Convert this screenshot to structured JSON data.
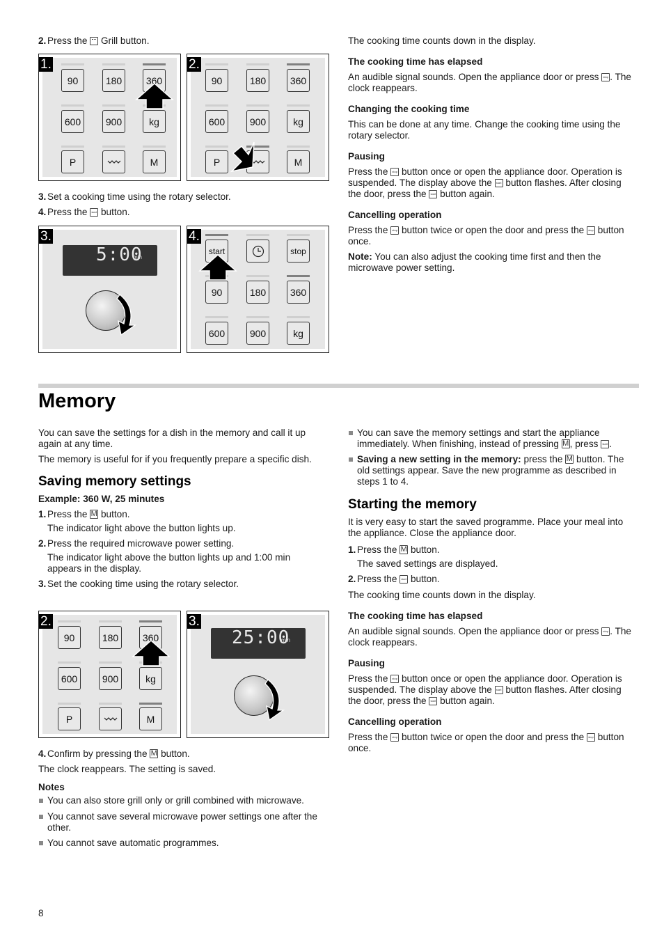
{
  "top_left": {
    "step2": {
      "num": "2.",
      "pre": "Press the",
      "icon": "grill-key-icon",
      "post": "Grill button."
    },
    "step3": {
      "num": "3.",
      "text": "Set a cooking time using the rotary selector."
    },
    "step4": {
      "num": "4.",
      "pre": "Press the",
      "icon": "start-key-icon",
      "post": "button."
    },
    "figures": {
      "fig1": {
        "tag": "1.",
        "keys": [
          "90",
          "180",
          "360",
          "600",
          "900",
          "kg",
          "P",
          "grill",
          "M"
        ],
        "active_indicators": [
          "360"
        ],
        "arrow": "up-arrow on 360"
      },
      "fig2": {
        "tag": "2.",
        "keys": [
          "90",
          "180",
          "360",
          "600",
          "900",
          "kg",
          "P",
          "grill",
          "M"
        ],
        "active_indicators": [
          "360",
          "grill"
        ],
        "arrow": "diagonal arrow on grill"
      },
      "fig3": {
        "tag": "3.",
        "display": "5:00",
        "display_unit": "min"
      },
      "fig4": {
        "tag": "4.",
        "keys": [
          "start",
          "clock",
          "stop",
          "90",
          "180",
          "360",
          "600",
          "900",
          "kg"
        ],
        "active_indicators": [
          "start",
          "360"
        ],
        "arrow": "up-arrow on start"
      }
    }
  },
  "top_right": {
    "intro": "The cooking time counts down in the display.",
    "sections": [
      {
        "heading": "The cooking time has elapsed",
        "text_a": "An audible signal sounds. Open the appliance door or press",
        "text_b": ". The clock reappears."
      },
      {
        "heading": "Changing the cooking time",
        "text": "This can be done at any time. Change the cooking time using the rotary selector."
      },
      {
        "heading": "Pausing",
        "t1": "Press the",
        "t2": "button once or open the appliance door. Operation is suspended. The display above the",
        "t3": "button flashes. After closing the door, press the",
        "t4": "button again."
      },
      {
        "heading": "Cancelling operation",
        "t1": "Press the",
        "t2": "button twice or open the door and press the",
        "t3": "button once."
      }
    ],
    "note_label": "Note:",
    "note_text": "You can also adjust the cooking time first and then the microwave power setting."
  },
  "memory": {
    "title": "Memory",
    "intro1": "You can save the settings for a dish in the memory and call it up again at any time.",
    "intro2": "The memory is useful for if you frequently prepare a specific dish.",
    "saving": {
      "heading": "Saving memory settings",
      "example": "Example: 360 W, 25 minutes",
      "steps": [
        {
          "num": "1.",
          "pre": "Press the",
          "key": "M",
          "post": "button.",
          "sub": "The indicator light above the button lights up."
        },
        {
          "num": "2.",
          "text": "Press the required microwave power setting.",
          "sub": "The indicator light above the button lights up and 1:00 min appears in the display."
        },
        {
          "num": "3.",
          "text": "Set the cooking time using the rotary selector."
        },
        {
          "num": "4.",
          "pre": "Confirm by pressing the",
          "key": "M",
          "post": "button."
        }
      ],
      "figures": {
        "fig2": {
          "tag": "2.",
          "keys": [
            "90",
            "180",
            "360",
            "600",
            "900",
            "kg",
            "P",
            "grill",
            "M"
          ],
          "active_indicators": [
            "360",
            "M"
          ]
        },
        "fig3": {
          "tag": "3.",
          "display": "25:00",
          "display_unit": "min"
        }
      },
      "result": "The clock reappears. The setting is saved.",
      "notes_heading": "Notes",
      "notes": [
        "You can also store grill only or grill combined with microwave.",
        "You cannot save several microwave power settings one after the other.",
        "You cannot save automatic programmes."
      ]
    },
    "right_bullets": {
      "b1_pre": "You can save the memory settings and start the appliance immediately. When finishing, instead of pressing",
      "b1_mid": ", press",
      "b1_post": ".",
      "b2_bold": "Saving a new setting in the memory:",
      "b2_pre": " press the",
      "b2_post": "button. The old settings appear. Save the new programme as described in steps 1 to 4."
    },
    "starting": {
      "heading": "Starting the memory",
      "intro": "It is very easy to start the saved programme. Place your meal into the appliance. Close the appliance door.",
      "steps": [
        {
          "num": "1.",
          "pre": "Press the",
          "key": "M",
          "post": "button.",
          "sub": "The saved settings are displayed."
        },
        {
          "num": "2.",
          "pre": "Press the",
          "post": "button."
        }
      ],
      "countdown": "The cooking time counts down in the display.",
      "elapsed_heading": "The cooking time has elapsed",
      "elapsed_a": "An audible signal sounds. Open the appliance door or press",
      "elapsed_b": ". The clock reappears.",
      "pausing_heading": "Pausing",
      "pausing_t1": "Press the",
      "pausing_t2": "button once or open the appliance door. Operation is suspended. The display above the",
      "pausing_t3": "button flashes. After closing the door, press the",
      "pausing_t4": "button again.",
      "cancel_heading": "Cancelling operation",
      "cancel_t1": "Press the",
      "cancel_t2": "button twice or open the door and press the",
      "cancel_t3": "button once."
    }
  },
  "key_labels": {
    "start": "start",
    "stop": "stop",
    "M": "M"
  },
  "page_number": "8"
}
